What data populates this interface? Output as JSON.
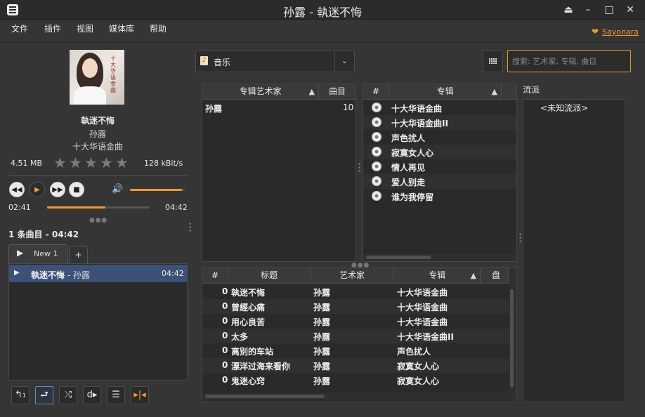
{
  "window": {
    "title": "孙露 - 執迷不悔"
  },
  "menu": {
    "items": [
      "文件",
      "插件",
      "视图",
      "媒体库",
      "帮助"
    ],
    "sayonara_link": "Sayonara"
  },
  "now_playing": {
    "title": "執迷不悔",
    "artist": "孙露",
    "album": "十大华语金曲",
    "filesize": "4.51 MB",
    "bitrate": "128 kBit/s",
    "rating": 0,
    "rating_max": 5,
    "cover_text": "十大华语金曲",
    "time_current": "02:41",
    "time_total": "04:42",
    "progress_fraction": 0.57,
    "volume_fraction": 0.95
  },
  "playlist": {
    "summary": "1 条曲目 - 04:42",
    "tab_label": "New 1",
    "add_tab_label": "+",
    "rows": [
      {
        "title": "執迷不悔",
        "artist_sep": " - ",
        "artist": "孙露",
        "time": "04:42"
      }
    ]
  },
  "library": {
    "selector_label": "音乐",
    "search_placeholder": "搜索: 艺术家, 专辑, 曲目",
    "artist_table": {
      "headers": [
        "专辑艺术家",
        "曲目"
      ],
      "rows": [
        {
          "name": "孙露",
          "tracks": "10"
        }
      ]
    },
    "album_table": {
      "headers": [
        "#",
        "专辑"
      ],
      "rows": [
        "十大华语金曲",
        "十大华语金曲II",
        "声色扰人",
        "寂寞女人心",
        "情人再见",
        "爱人别走",
        "谁为我停留"
      ]
    },
    "genre": {
      "label": "流派",
      "items": [
        "<未知流派>"
      ]
    },
    "tracks_table": {
      "headers": [
        "#",
        "标题",
        "艺术家",
        "专辑",
        "盘号"
      ],
      "rows": [
        {
          "num": "0",
          "title": "執迷不悔",
          "artist": "孙露",
          "album": "十大华语金曲"
        },
        {
          "num": "0",
          "title": "曾經心痛",
          "artist": "孙露",
          "album": "十大华语金曲"
        },
        {
          "num": "0",
          "title": "用心良苦",
          "artist": "孙露",
          "album": "十大华语金曲"
        },
        {
          "num": "0",
          "title": "太多",
          "artist": "孙露",
          "album": "十大华语金曲II"
        },
        {
          "num": "0",
          "title": "离别的车站",
          "artist": "孙露",
          "album": "声色扰人"
        },
        {
          "num": "0",
          "title": "漂洋过海来看你",
          "artist": "孙露",
          "album": "寂寞女人心"
        },
        {
          "num": "0",
          "title": "鬼迷心窍",
          "artist": "孙露",
          "album": "寂寞女人心"
        }
      ]
    }
  },
  "colors": {
    "accent": "#f39a2c",
    "selection": "#3c5078",
    "background": "#353535",
    "panel": "#2a2a2a"
  }
}
